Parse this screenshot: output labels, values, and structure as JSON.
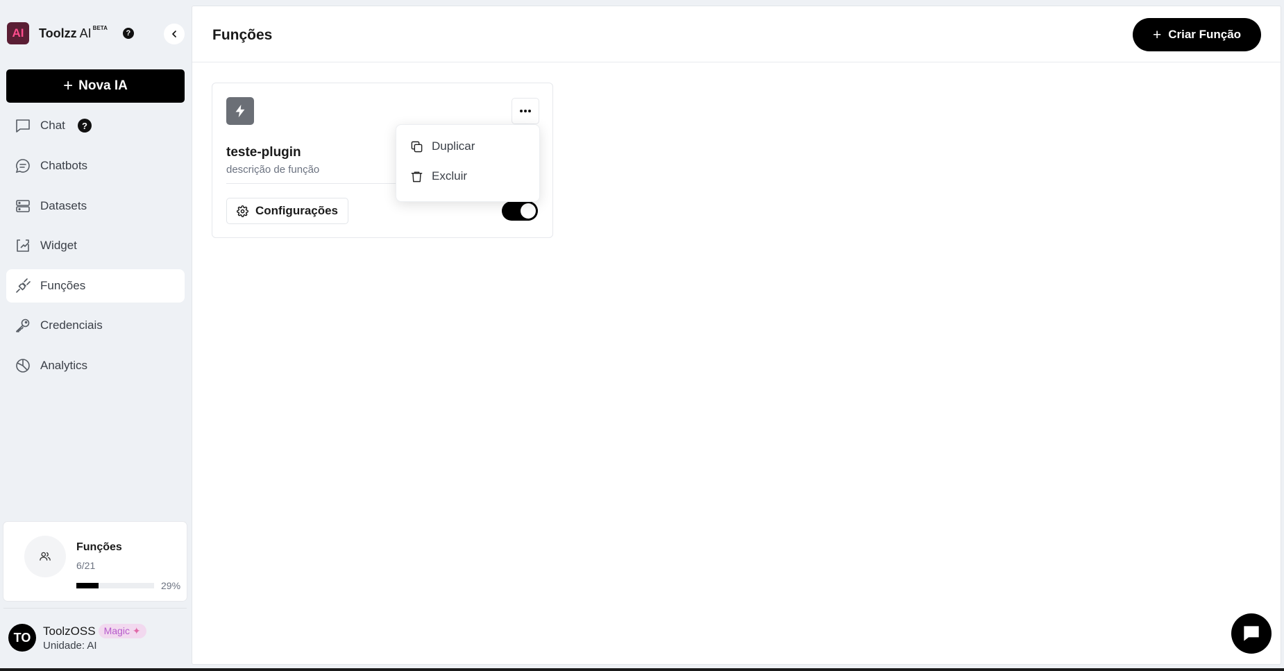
{
  "brand": {
    "logo_text": "AI",
    "name": "Toolzz",
    "suffix": "AI",
    "badge": "BETA",
    "help": "?"
  },
  "sidebar": {
    "new_button": {
      "icon": "plus-icon",
      "label": "Nova IA"
    },
    "items": [
      {
        "label": "Chat",
        "icon": "chat-icon",
        "help": "?"
      },
      {
        "label": "Chatbots",
        "icon": "message-circle-icon"
      },
      {
        "label": "Datasets",
        "icon": "server-icon"
      },
      {
        "label": "Widget",
        "icon": "widget-icon"
      },
      {
        "label": "Funções",
        "icon": "plug-icon",
        "active": true
      },
      {
        "label": "Credenciais",
        "icon": "key-icon"
      },
      {
        "label": "Analytics",
        "icon": "pie-chart-icon"
      }
    ],
    "usage": {
      "title": "Funções",
      "count": "6/21",
      "percent_label": "29%",
      "progress": 0.29
    },
    "user": {
      "initials": "TO",
      "name": "ToolzOSS",
      "badge": "Magic",
      "unit": "Unidade: AI"
    }
  },
  "main": {
    "title": "Funções",
    "create_button": "Criar Função",
    "cards": [
      {
        "name": "teste-plugin",
        "description": "descrição de função",
        "config_button": "Configurações",
        "enabled": true
      }
    ],
    "menu": {
      "items": [
        {
          "label": "Duplicar",
          "icon": "copy-icon"
        },
        {
          "label": "Excluir",
          "icon": "trash-icon"
        }
      ]
    }
  },
  "colors": {
    "sidebar_bg": "#eef1f5",
    "accent": "#000000",
    "brand_logo_bg": "#5a1e34",
    "brand_logo_fg": "#ff4d8d",
    "magic_badge_bg": "#f2d9ef",
    "magic_badge_fg": "#b55acb"
  }
}
